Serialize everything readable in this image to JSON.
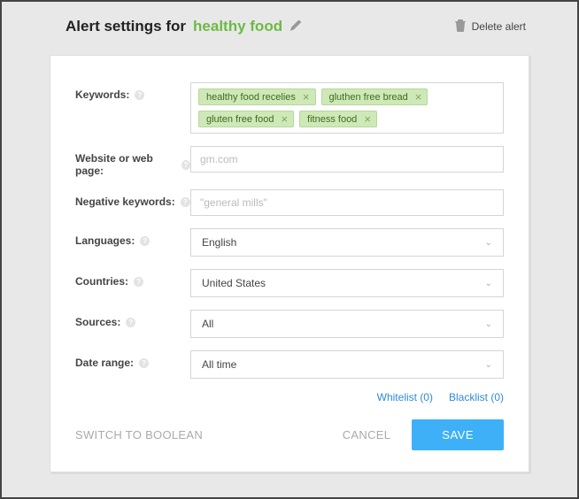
{
  "header": {
    "title_prefix": "Alert settings for",
    "alert_name": "healthy food",
    "delete_label": "Delete alert"
  },
  "labels": {
    "keywords": "Keywords:",
    "website": "Website or web page:",
    "negative": "Negative keywords:",
    "languages": "Languages:",
    "countries": "Countries:",
    "sources": "Sources:",
    "date_range": "Date range:"
  },
  "keywords": [
    "healthy food recelies",
    "gluthen free bread",
    "gluten free food",
    "fitness food"
  ],
  "website_placeholder": "gm.com",
  "negative_placeholder": "\"general mills\"",
  "languages_value": "English",
  "countries_value": "United States",
  "sources_value": "All",
  "date_range_value": "All time",
  "links": {
    "whitelist": "Whitelist (0)",
    "blacklist": "Blacklist (0)"
  },
  "footer": {
    "switch_boolean": "SWITCH TO BOOLEAN",
    "cancel": "CANCEL",
    "save": "SAVE"
  }
}
